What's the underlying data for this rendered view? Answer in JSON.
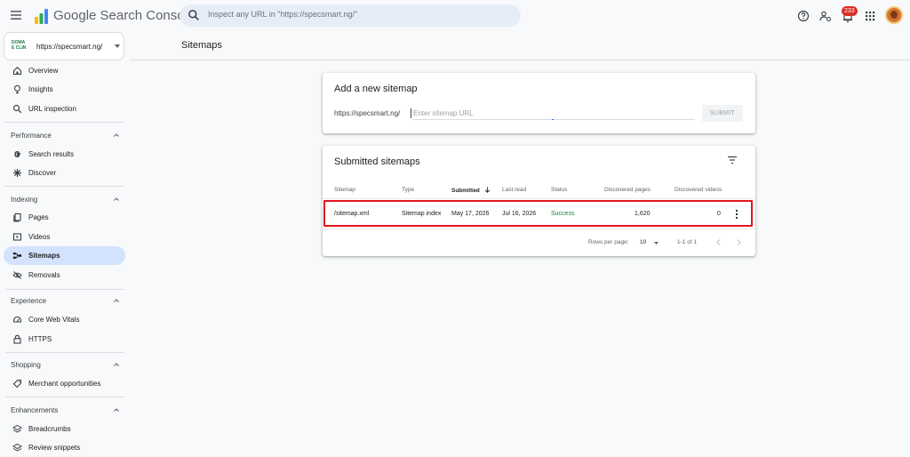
{
  "app": {
    "brand": "Google Search Console",
    "search_placeholder": "Inspect any URL in \"https://specsmart.ng/\"",
    "notification_count": "233",
    "icons": [
      "menu-icon",
      "search-console-logo",
      "search-icon",
      "help-icon",
      "people-settings-icon",
      "notifications-icon",
      "apps-grid-icon",
      "avatar"
    ]
  },
  "property": {
    "logo_text": [
      "DOMA",
      "E CLIN"
    ],
    "name": "https://specsmart.ng/"
  },
  "sidebar": {
    "top_items": [
      {
        "label": "Overview",
        "icon": "home-icon"
      },
      {
        "label": "Insights",
        "icon": "lightbulb-icon"
      },
      {
        "label": "URL inspection",
        "icon": "search-icon"
      }
    ],
    "performance": {
      "title": "Performance",
      "items": [
        {
          "label": "Search results",
          "icon": "google-g-icon"
        },
        {
          "label": "Discover",
          "icon": "asterisk-icon"
        }
      ]
    },
    "indexing": {
      "title": "Indexing",
      "items": [
        {
          "label": "Pages",
          "icon": "pages-icon"
        },
        {
          "label": "Videos",
          "icon": "video-icon"
        },
        {
          "label": "Sitemaps",
          "icon": "sitemap-icon",
          "active": true
        },
        {
          "label": "Removals",
          "icon": "removals-icon"
        }
      ]
    },
    "experience": {
      "title": "Experience",
      "items": [
        {
          "label": "Core Web Vitals",
          "icon": "speed-gauge-icon"
        },
        {
          "label": "HTTPS",
          "icon": "lock-icon"
        }
      ]
    },
    "shopping": {
      "title": "Shopping",
      "items": [
        {
          "label": "Merchant opportunities",
          "icon": "tag-icon"
        }
      ]
    },
    "enhancements": {
      "title": "Enhancements",
      "items": [
        {
          "label": "Breadcrumbs",
          "icon": "layers-icon"
        },
        {
          "label": "Review snippets",
          "icon": "layers-icon"
        }
      ]
    }
  },
  "main": {
    "page_title": "Sitemaps",
    "add_sitemap": {
      "title": "Add a new sitemap",
      "prefix": "https://specsmart.ng/",
      "placeholder": "Enter sitemap URL",
      "submit_label": "SUBMIT"
    },
    "submitted": {
      "title": "Submitted sitemaps",
      "columns": {
        "sitemap": "Sitemap",
        "type": "Type",
        "submitted": "Submitted",
        "last_read": "Last read",
        "status": "Status",
        "discovered_pages": "Discovered pages",
        "discovered_videos": "Discovered videos"
      },
      "rows": [
        {
          "sitemap": "/sitemap.xml",
          "type": "Sitemap index",
          "submitted": "May 17, 2026",
          "last_read": "Jul 16, 2026",
          "status": "Success",
          "discovered_pages": "1,620",
          "discovered_videos": "0"
        }
      ],
      "pagination": {
        "rows_per_page_label": "Rows per page:",
        "rows_per_page": "10",
        "range": "1-1 of 1"
      }
    }
  },
  "colors": {
    "active_nav": "#d3e3fd",
    "success": "#188038",
    "highlight_box": "#e2141d",
    "badge": "#d93025"
  }
}
